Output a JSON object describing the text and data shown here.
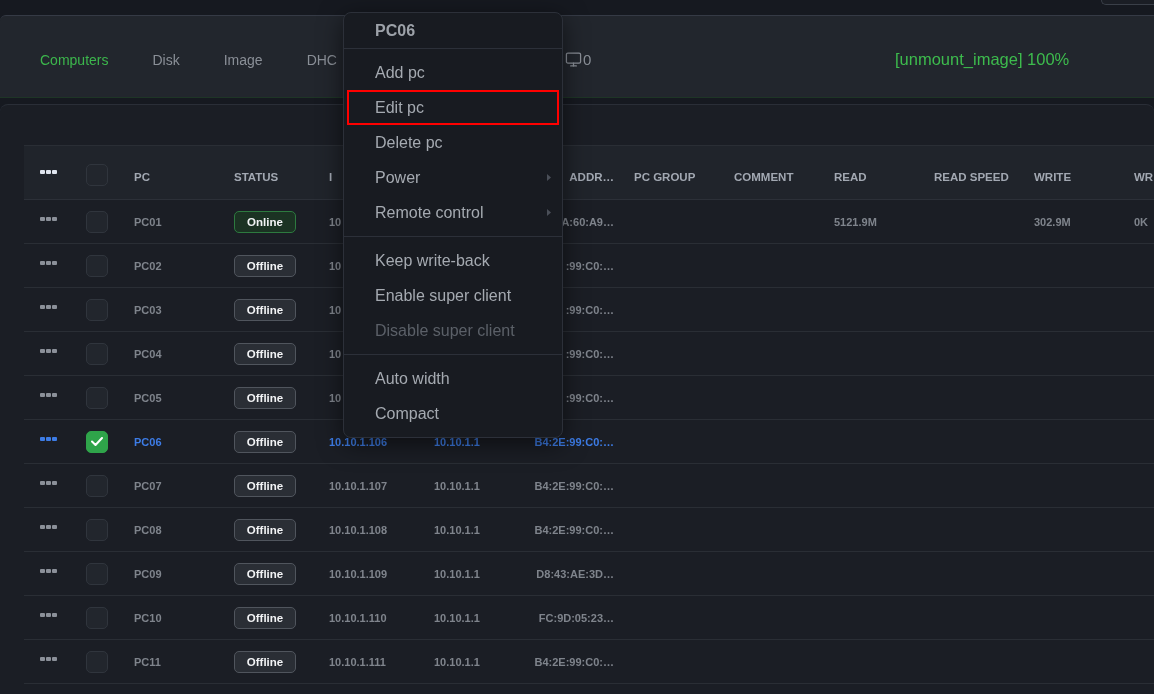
{
  "top_bar": {
    "tabs": [
      {
        "label": "Computers",
        "selected": true
      },
      {
        "label": "Disk",
        "selected": false
      },
      {
        "label": "Image",
        "selected": false
      },
      {
        "label": "DHC",
        "selected": false
      }
    ],
    "online_count": "0",
    "task_status": "[unmount_image] 100%"
  },
  "table": {
    "all_selected": false,
    "columns": [
      "PC",
      "STATUS",
      "I",
      null,
      "ADDR…",
      "PC GROUP",
      "COMMENT",
      "READ",
      "READ SPEED",
      "WRITE",
      "WR"
    ],
    "rows": [
      {
        "selected": false,
        "online": true,
        "cells": [
          "PC01",
          "Online",
          "10",
          null,
          "A:60:A9…",
          null,
          null,
          "5121.9M",
          null,
          "302.9M",
          "0K"
        ]
      },
      {
        "selected": false,
        "online": false,
        "cells": [
          "PC02",
          "Offline",
          "10",
          null,
          ":99:C0:…"
        ]
      },
      {
        "selected": false,
        "online": false,
        "cells": [
          "PC03",
          "Offline",
          "10",
          null,
          ":99:C0:…"
        ]
      },
      {
        "selected": false,
        "online": false,
        "cells": [
          "PC04",
          "Offline",
          "10",
          null,
          ":99:C0:…"
        ]
      },
      {
        "selected": false,
        "online": false,
        "cells": [
          "PC05",
          "Offline",
          "10",
          null,
          ":99:C0:…"
        ]
      },
      {
        "selected": true,
        "online": false,
        "cells": [
          "PC06",
          "Offline",
          "10.10.1.106",
          "10.10.1.1",
          "B4:2E:99:C0:…"
        ]
      },
      {
        "selected": false,
        "online": false,
        "cells": [
          "PC07",
          "Offline",
          "10.10.1.107",
          "10.10.1.1",
          "B4:2E:99:C0:…"
        ]
      },
      {
        "selected": false,
        "online": false,
        "cells": [
          "PC08",
          "Offline",
          "10.10.1.108",
          "10.10.1.1",
          "B4:2E:99:C0:…"
        ]
      },
      {
        "selected": false,
        "online": false,
        "cells": [
          "PC09",
          "Offline",
          "10.10.1.109",
          "10.10.1.1",
          "D8:43:AE:3D…"
        ]
      },
      {
        "selected": false,
        "online": false,
        "cells": [
          "PC10",
          "Offline",
          "10.10.1.110",
          "10.10.1.1",
          "FC:9D:05:23…"
        ]
      },
      {
        "selected": false,
        "online": false,
        "cells": [
          "PC11",
          "Offline",
          "10.10.1.111",
          "10.10.1.1",
          "B4:2E:99:C0:…"
        ]
      }
    ]
  },
  "context_menu": {
    "title": "PC06",
    "groups": [
      {
        "items": [
          {
            "label": "Add pc",
            "highlighted": false,
            "disabled": false,
            "submenu": false
          },
          {
            "label": "Edit pc",
            "highlighted": true,
            "disabled": false,
            "submenu": false
          },
          {
            "label": "Delete pc",
            "highlighted": false,
            "disabled": false,
            "submenu": false
          },
          {
            "label": "Power",
            "highlighted": false,
            "disabled": false,
            "submenu": true
          },
          {
            "label": "Remote control",
            "highlighted": false,
            "disabled": false,
            "submenu": true
          }
        ]
      },
      {
        "items": [
          {
            "label": "Keep write-back",
            "highlighted": false,
            "disabled": false,
            "submenu": false
          },
          {
            "label": "Enable super client",
            "highlighted": false,
            "disabled": false,
            "submenu": false
          },
          {
            "label": "Disable super client",
            "highlighted": false,
            "disabled": true,
            "submenu": false
          }
        ]
      },
      {
        "items": [
          {
            "label": "Auto width",
            "highlighted": false,
            "disabled": false,
            "submenu": false
          },
          {
            "label": "Compact",
            "highlighted": false,
            "disabled": false,
            "submenu": false
          }
        ]
      }
    ]
  }
}
